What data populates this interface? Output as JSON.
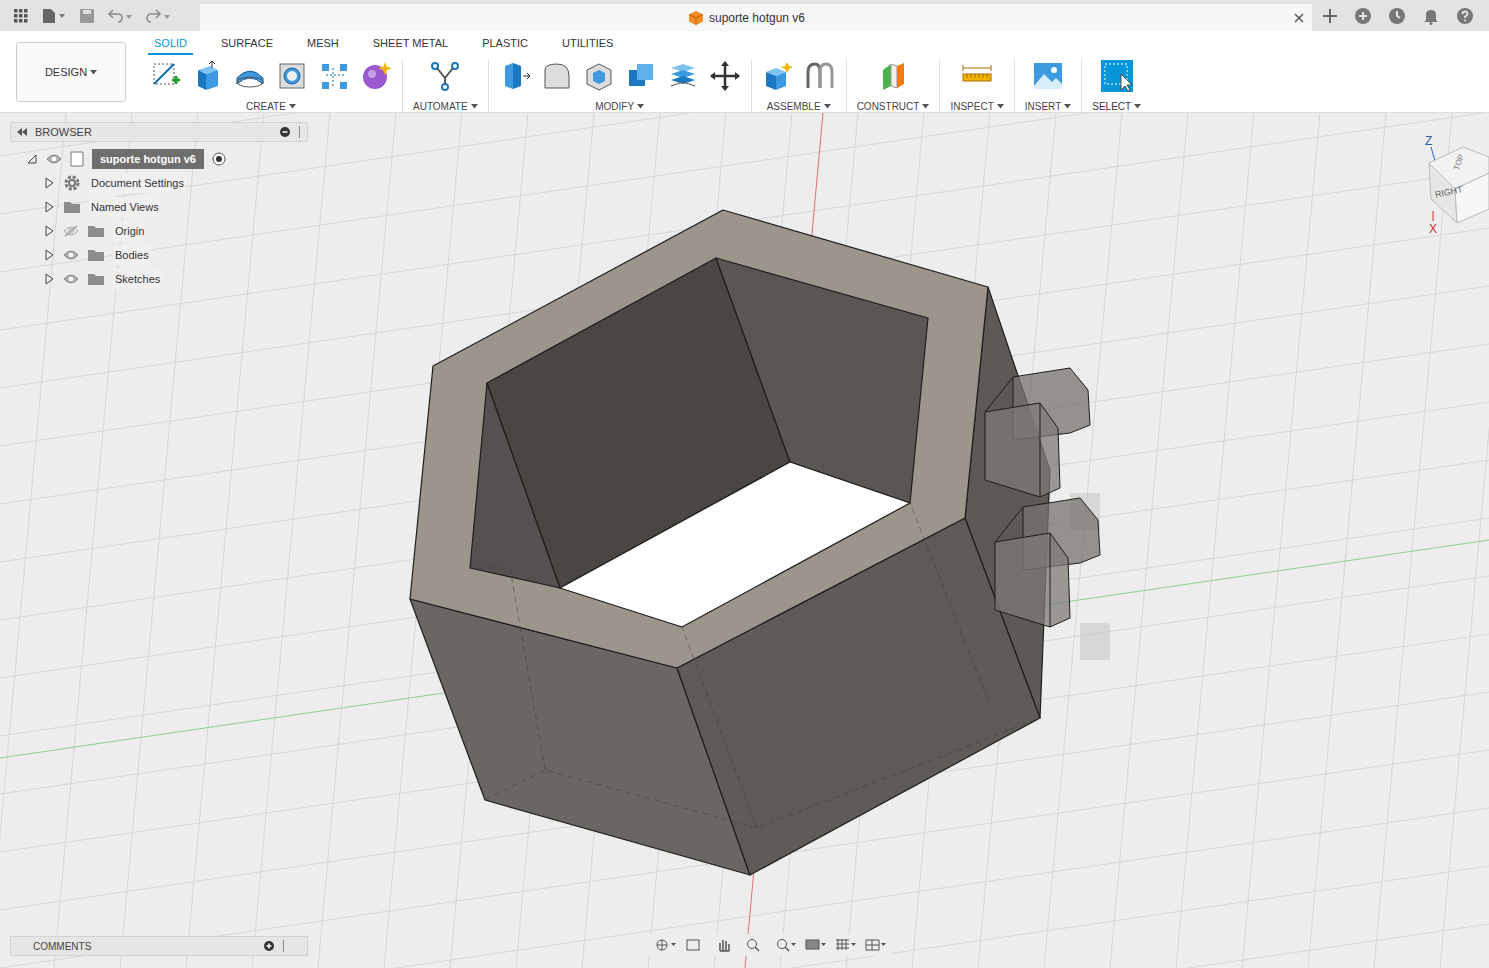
{
  "window": {
    "title": "suporte hotgun v6"
  },
  "workspace": {
    "label": "DESIGN"
  },
  "tabs": [
    {
      "label": "SOLID",
      "selected": true
    },
    {
      "label": "SURFACE",
      "selected": false
    },
    {
      "label": "MESH",
      "selected": false
    },
    {
      "label": "SHEET METAL",
      "selected": false
    },
    {
      "label": "PLASTIC",
      "selected": false
    },
    {
      "label": "UTILITIES",
      "selected": false
    }
  ],
  "toolbar_groups": [
    {
      "label": "CREATE"
    },
    {
      "label": "AUTOMATE"
    },
    {
      "label": "MODIFY"
    },
    {
      "label": "ASSEMBLE"
    },
    {
      "label": "CONSTRUCT"
    },
    {
      "label": "INSPECT"
    },
    {
      "label": "INSERT"
    },
    {
      "label": "SELECT",
      "selected": true
    }
  ],
  "browser": {
    "title": "BROWSER",
    "root": {
      "label": "suporte hotgun v6",
      "expanded": true,
      "visible": true,
      "selected": true
    },
    "items": [
      {
        "label": "Document Settings",
        "kind": "settings",
        "expanded": false
      },
      {
        "label": "Named Views",
        "kind": "plain",
        "expanded": false
      },
      {
        "label": "Origin",
        "kind": "toggle",
        "expanded": false,
        "visible": false
      },
      {
        "label": "Bodies",
        "kind": "toggle",
        "expanded": false,
        "visible": true
      },
      {
        "label": "Sketches",
        "kind": "toggle",
        "expanded": false,
        "visible": true
      }
    ]
  },
  "comments": {
    "title": "COMMENTS"
  },
  "viewcube": {
    "face": "RIGHT",
    "top": "TOP",
    "axes": [
      "Z",
      "X"
    ]
  }
}
